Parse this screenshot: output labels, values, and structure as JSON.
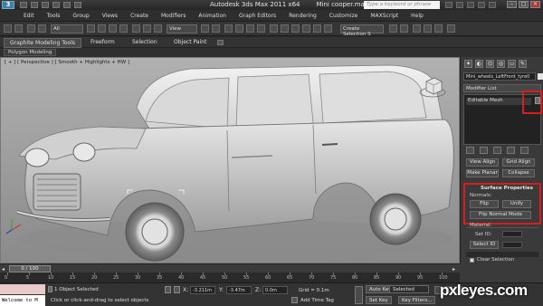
{
  "titlebar": {
    "title": "Autodesk 3ds Max  2011 x64",
    "file": "Mini cooper.max",
    "search_placeholder": "Type a keyword or phrase"
  },
  "menu": [
    "Edit",
    "Tools",
    "Group",
    "Views",
    "Create",
    "Modifiers",
    "Animation",
    "Graph Editors",
    "Rendering",
    "Customize",
    "MAXScript",
    "Help"
  ],
  "toolbar": {
    "filter": "All",
    "view": "View",
    "selection_set": "Create Selection S"
  },
  "ribbon": {
    "tabs": [
      "Graphite Modeling Tools",
      "Freeform",
      "Selection",
      "Object Paint"
    ],
    "subtab": "Polygon Modeling"
  },
  "viewport": {
    "label": "[ + ] [ Perspective ] [ Smooth + Highlights + HW ]"
  },
  "command_panel": {
    "object_name": "Mini_wheels_LeftFront_tyre0",
    "modifier_list": "Modifier List",
    "stack_item": "Editable Mesh",
    "view_align": "View Align",
    "grid_align": "Grid Align",
    "make_planar": "Make Planar",
    "collapse": "Collapse",
    "surface_properties": "Surface Properties",
    "normals_label": "Normals:",
    "flip": "Flip",
    "unify": "Unify",
    "flip_normal_mode": "Flip Normal Mode",
    "material_label": "Material:",
    "set_id": "Set ID:",
    "select_id": "Select ID",
    "clear_selection": "Clear Selection"
  },
  "timeline": {
    "frame": "0 / 100",
    "ticks": [
      "0",
      "5",
      "10",
      "15",
      "20",
      "25",
      "30",
      "35",
      "40",
      "45",
      "50",
      "55",
      "60",
      "65",
      "70",
      "75",
      "80",
      "85",
      "90",
      "95",
      "100"
    ]
  },
  "statusbar": {
    "listener_text": "Welcome to M",
    "selected": "1 Object Selected",
    "prompt": "Click or click-and-drag to select objects",
    "x_label": "X:",
    "x_value": "-3.211m",
    "y_label": "Y:",
    "y_value": "-3.47m",
    "z_label": "Z:",
    "z_value": "0.0m",
    "grid": "Grid = 0.1m",
    "add_time_tag": "Add Time Tag",
    "auto_key": "Auto Key",
    "selected_dd": "Selected",
    "set_key": "Set Key",
    "key_filters": "Key Filters..."
  },
  "watermark": "pxleyes.com",
  "colors": {
    "highlight_red": "#d61e1e",
    "viewport_bg": "#a0a0a0",
    "panel_bg": "#3a3a3a"
  }
}
